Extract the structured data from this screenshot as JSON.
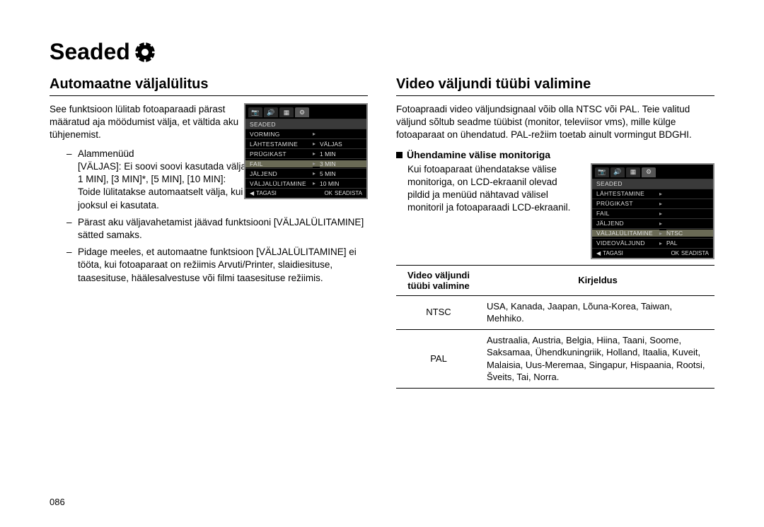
{
  "page_title": "Seaded",
  "page_number": "086",
  "left": {
    "heading": "Automaatne väljalülitus",
    "intro": "See funktsioon lülitab fotoaparaadi pärast määratud aja möödumist välja, et vältida aku tühjenemist.",
    "bullets": [
      {
        "lead": "Alammenüüd",
        "lines": [
          "[VÄLJAS]:  Ei soovi soovi kasutada väljalülitamise funktsiooni.",
          "1 MIN], [3 MIN]*, [5 MIN], [10 MIN]:",
          "Toide lülitatakse automaatselt välja, kui seadet määratud ajaperioodi jooksul ei kasutata."
        ]
      },
      {
        "lead": "Pärast aku väljavahetamist jäävad funktsiooni [VÄLJALÜLITAMINE] sätted samaks.",
        "lines": []
      },
      {
        "lead": "Pidage meeles, et automaatne funktsioon [VÄLJALÜLITAMINE] ei tööta, kui fotoaparaat on režiimis Arvuti/Printer, slaidiesituse, taasesituse, häälesalvestuse või filmi taasesituse režiimis.",
        "lines": []
      }
    ],
    "screen": {
      "header": "SEADED",
      "rows": [
        {
          "label": "VORMING",
          "value": ""
        },
        {
          "label": "LÄHTESTAMINE",
          "value": "VÄLJAS"
        },
        {
          "label": "PRÜGIKAST",
          "value": "1 MIN"
        },
        {
          "label": "FAIL",
          "value": "3 MIN",
          "hl": true
        },
        {
          "label": "JÄLJEND",
          "value": "5 MIN"
        },
        {
          "label": "VÄLJALÜLITAMINE",
          "value": "10 MIN"
        }
      ],
      "footer_back": "TAGASI",
      "footer_ok": "SEADISTA"
    }
  },
  "right": {
    "heading": "Video väljundi tüübi valimine",
    "intro": "Fotoapraadi video väljundsignaal võib olla NTSC või PAL. Teie valitud väljund sõltub seadme tüübist (monitor, televiisor vms), mille külge fotoaparaat on ühendatud. PAL-režiim toetab ainult vormingut BDGHI.",
    "sub_heading": "Ühendamine välise monitoriga",
    "sub_text": "Kui fotoaparaat ühendatakse välise monitoriga, on LCD-ekraanil olevad pildid ja menüüd nähtavad välisel monitoril ja fotoaparaadi LCD-ekraanil.",
    "screen": {
      "header": "SEADED",
      "rows": [
        {
          "label": "LÄHTESTAMINE",
          "value": ""
        },
        {
          "label": "PRÜGIKAST",
          "value": ""
        },
        {
          "label": "FAIL",
          "value": ""
        },
        {
          "label": "JÄLJEND",
          "value": ""
        },
        {
          "label": "VÄLJALÜLITAMINE",
          "value": "NTSC",
          "hl": true
        },
        {
          "label": "VIDEOVÄLJUND",
          "value": "PAL"
        }
      ],
      "footer_back": "TAGASI",
      "footer_ok": "SEADISTA"
    },
    "table": {
      "col1": "Video väljundi tüübi valimine",
      "col2": "Kirjeldus",
      "rows": [
        {
          "type": "NTSC",
          "desc": "USA, Kanada, Jaapan, Lõuna-Korea, Taiwan, Mehhiko."
        },
        {
          "type": "PAL",
          "desc": "Austraalia, Austria, Belgia, Hiina, Taani, Soome, Saksamaa, Ühendkuningriik, Holland, Itaalia, Kuveit, Malaisia, Uus-Meremaa, Singapur, Hispaania, Rootsi, Šveits, Tai, Norra."
        }
      ]
    }
  }
}
